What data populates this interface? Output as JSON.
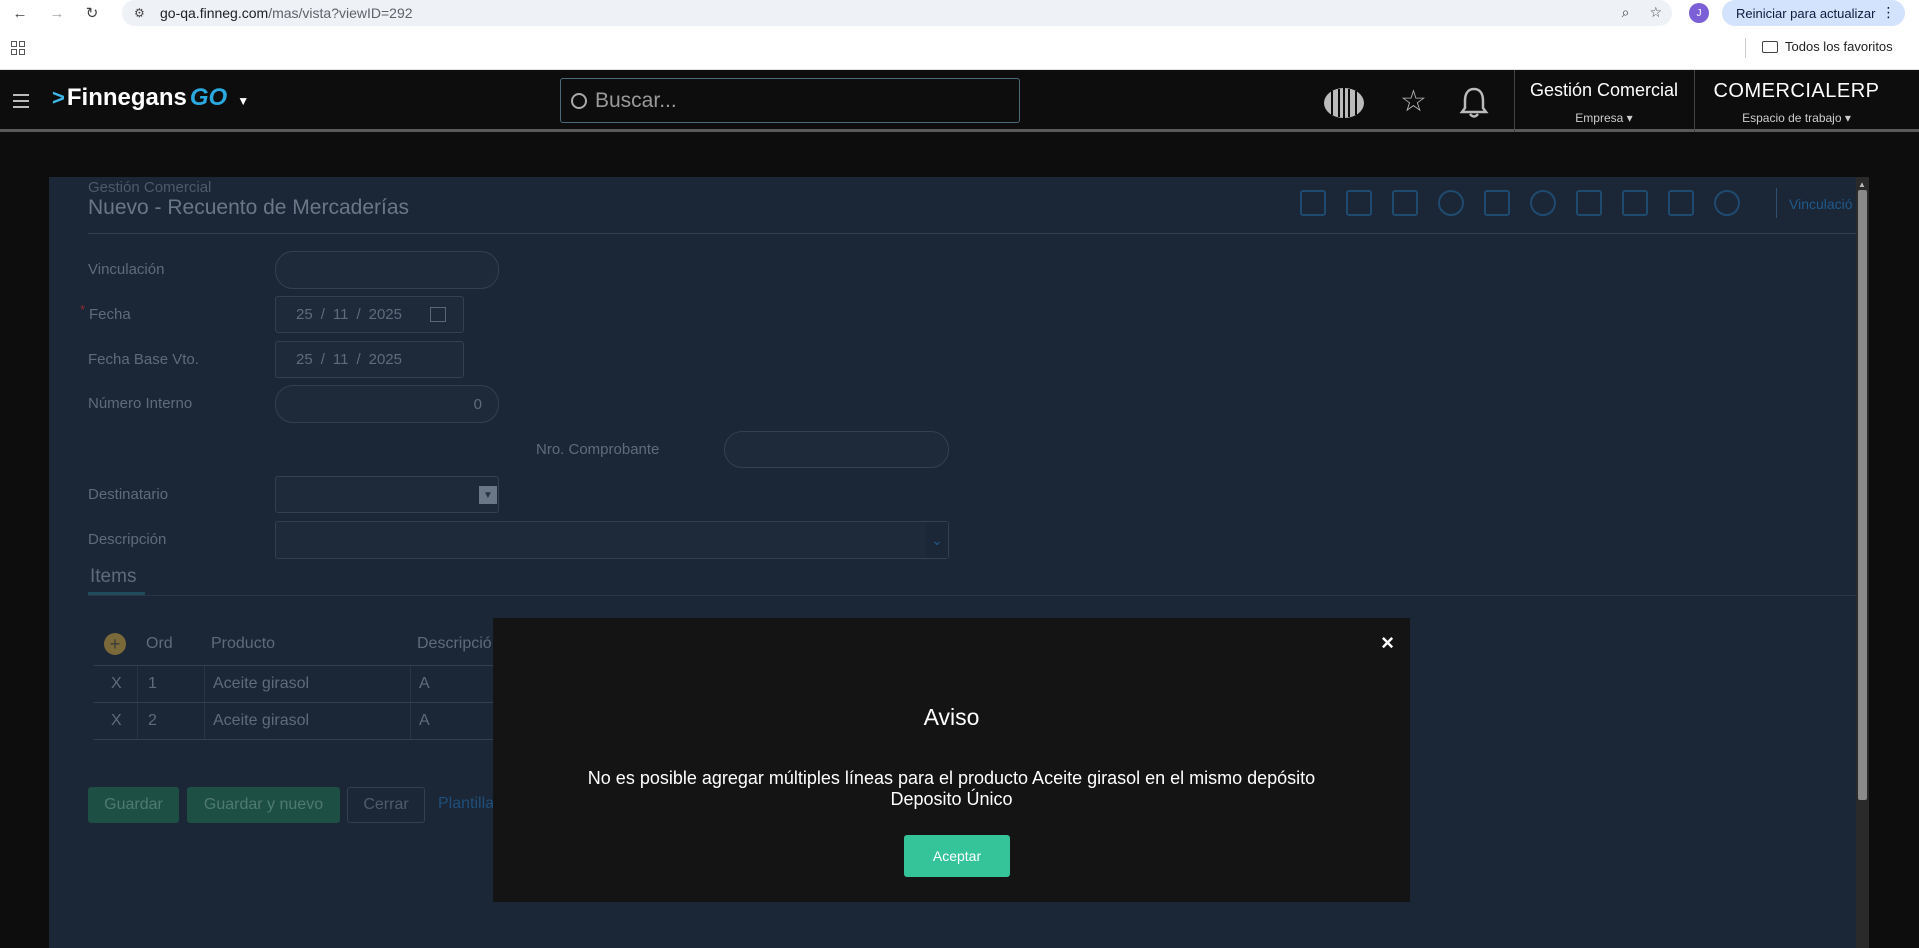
{
  "browser": {
    "url_host": "go-qa.finneg.com",
    "url_path": "/mas/vista?viewID=292",
    "profile_initial": "J",
    "update_label": "Reiniciar para actualizar",
    "bookmarks_all": "Todos los favoritos"
  },
  "header": {
    "logo_text": "Finnegans",
    "logo_suffix": "GO",
    "search_placeholder": "Buscar...",
    "company_name": "Gestión Comercial",
    "company_label": "Empresa",
    "workspace_name": "COMERCIALERP",
    "workspace_label": "Espacio de trabajo"
  },
  "page": {
    "breadcrumb": "Gestión Comercial",
    "title": "Nuevo - Recuento de Mercaderías",
    "toolbar_link": "Vinculació"
  },
  "form": {
    "vinculacion_label": "Vinculación",
    "fecha_label": "Fecha",
    "fecha_day": "25",
    "fecha_month": "11",
    "fecha_year": "2025",
    "fecha_base_label": "Fecha Base Vto.",
    "fecha_base_day": "25",
    "fecha_base_month": "11",
    "fecha_base_year": "2025",
    "numero_interno_label": "Número Interno",
    "numero_interno_value": "0",
    "nro_comprobante_label": "Nro. Comprobante",
    "destinatario_label": "Destinatario",
    "descripcion_label": "Descripción"
  },
  "items": {
    "tab_label": "Items",
    "columns": [
      "Ord",
      "Producto",
      "Descripció"
    ],
    "rows": [
      {
        "delete": "X",
        "ord": "1",
        "producto": "Aceite girasol",
        "descripcion": "A"
      },
      {
        "delete": "X",
        "ord": "2",
        "producto": "Aceite girasol",
        "descripcion": "A"
      }
    ]
  },
  "actions": {
    "guardar": "Guardar",
    "guardar_nuevo": "Guardar y nuevo",
    "cerrar": "Cerrar",
    "plantilla": "Plantilla"
  },
  "modal": {
    "title": "Aviso",
    "message": "No es posible agregar múltiples líneas para el producto Aceite girasol en el mismo depósito Deposito Único",
    "ok_label": "Aceptar",
    "close_glyph": "×"
  }
}
